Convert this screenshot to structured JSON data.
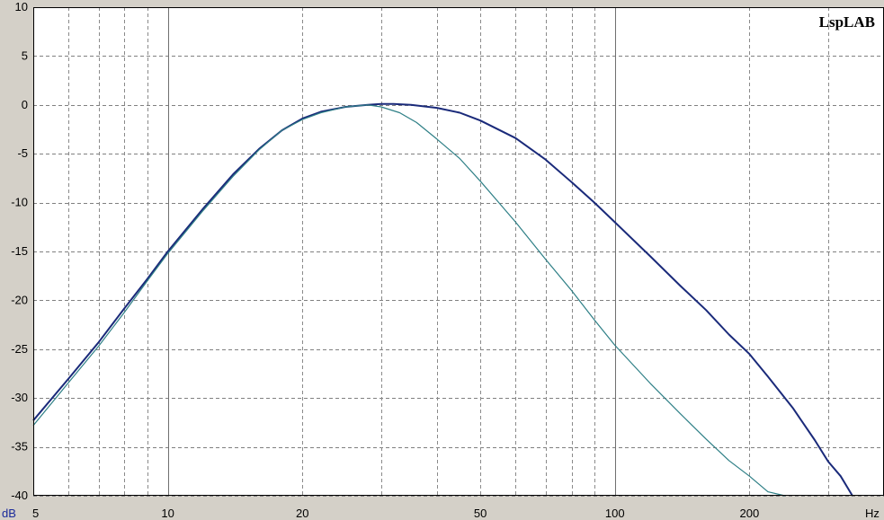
{
  "brand_label": "LspLAB",
  "chart_data": {
    "type": "line",
    "title": "",
    "xlabel": "Hz",
    "ylabel": "dB",
    "x_scale": "log",
    "xlim": [
      5,
      400
    ],
    "ylim": [
      -40,
      10
    ],
    "grid": true,
    "x_major_ticks": [
      5,
      10,
      20,
      50,
      100,
      200
    ],
    "x_tick_labels": [
      "5",
      "10",
      "20",
      "50",
      "100",
      "200"
    ],
    "y_ticks": [
      10,
      5,
      0,
      -5,
      -10,
      -15,
      -20,
      -25,
      -30,
      -35,
      -40
    ],
    "y_tick_labels": [
      "10",
      "5",
      "0",
      "-5",
      "-10",
      "-15",
      "-20",
      "-25",
      "-30",
      "-35",
      "-40"
    ],
    "series": [
      {
        "color": "#1a2a7a",
        "x": [
          5,
          6,
          7,
          8,
          9,
          10,
          12,
          14,
          16,
          18,
          20,
          22,
          25,
          28,
          30,
          32,
          35,
          40,
          45,
          50,
          60,
          70,
          80,
          90,
          100,
          120,
          140,
          160,
          180,
          200,
          220,
          250,
          280,
          300,
          320,
          340
        ],
        "y": [
          -32.3,
          -28.0,
          -24.3,
          -20.8,
          -17.8,
          -15.0,
          -10.6,
          -7.1,
          -4.5,
          -2.6,
          -1.4,
          -0.7,
          -0.2,
          0.0,
          0.1,
          0.1,
          0.0,
          -0.3,
          -0.8,
          -1.6,
          -3.4,
          -5.6,
          -7.9,
          -10.0,
          -12.0,
          -15.5,
          -18.5,
          -21.0,
          -23.5,
          -25.5,
          -27.8,
          -31.0,
          -34.3,
          -36.5,
          -38.0,
          -40.0
        ]
      },
      {
        "color": "#2e7f86",
        "x": [
          5,
          6,
          7,
          8,
          9,
          10,
          12,
          14,
          16,
          18,
          20,
          22,
          25,
          28,
          30,
          33,
          36,
          40,
          45,
          50,
          55,
          60,
          70,
          80,
          90,
          100,
          120,
          140,
          160,
          180,
          200,
          220,
          240
        ],
        "y": [
          -32.8,
          -28.4,
          -24.7,
          -21.2,
          -18.0,
          -15.2,
          -10.8,
          -7.3,
          -4.6,
          -2.6,
          -1.5,
          -0.8,
          -0.2,
          0.0,
          -0.2,
          -0.8,
          -1.8,
          -3.5,
          -5.5,
          -7.8,
          -10.0,
          -12.0,
          -15.8,
          -19.0,
          -22.0,
          -24.6,
          -28.5,
          -31.6,
          -34.2,
          -36.4,
          -38.0,
          -39.6,
          -40.0
        ]
      }
    ]
  }
}
